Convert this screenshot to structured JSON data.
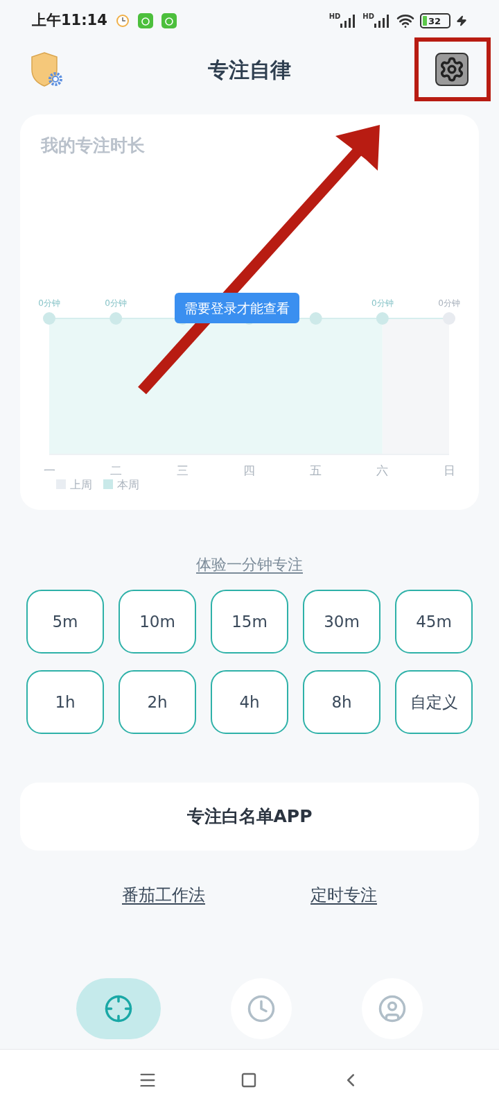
{
  "status_bar": {
    "time": "上午11:14",
    "network_labels": [
      "HD",
      "HD"
    ],
    "battery": "32"
  },
  "header": {
    "title": "专注自律"
  },
  "chart": {
    "title": "我的专注时长",
    "notice": "需要登录才能查看",
    "days": [
      {
        "label": "一",
        "value_label": "0分钟",
        "this_week": true
      },
      {
        "label": "二",
        "value_label": "0分钟",
        "this_week": true
      },
      {
        "label": "三",
        "this_week": true
      },
      {
        "label": "四",
        "this_week": true
      },
      {
        "label": "五",
        "this_week": true
      },
      {
        "label": "六",
        "value_label": "0分钟",
        "this_week": true
      },
      {
        "label": "日",
        "value_label": "0分钟",
        "this_week": false
      }
    ],
    "legend": [
      {
        "label": "上周",
        "color": "#e9edf2"
      },
      {
        "label": "本周",
        "color": "#c9e9e9"
      }
    ]
  },
  "trial_link": "体验一分钟专注",
  "durations": [
    "5m",
    "10m",
    "15m",
    "30m",
    "45m",
    "1h",
    "2h",
    "4h",
    "8h",
    "自定义"
  ],
  "whitelist_button": "专注白名单APP",
  "links": [
    "番茄工作法",
    "定时专注"
  ],
  "bottom_nav": [
    {
      "kind": "focus",
      "selected": true
    },
    {
      "kind": "history",
      "selected": false
    },
    {
      "kind": "profile",
      "selected": false
    }
  ]
}
